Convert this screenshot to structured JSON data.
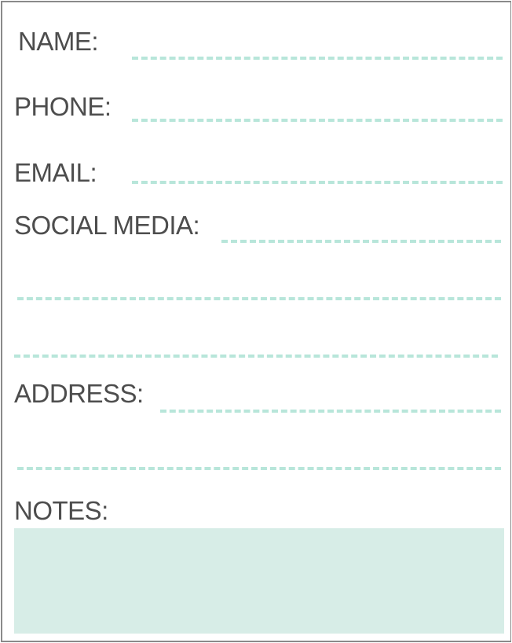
{
  "form": {
    "name_label": "NAME:",
    "phone_label": "PHONE:",
    "email_label": "EMAIL:",
    "social_label": "SOCIAL MEDIA:",
    "address_label": "ADDRESS:",
    "notes_label": "NOTES:"
  },
  "colors": {
    "text": "#4d4d4d",
    "dash": "#b8e6da",
    "notes_fill": "#d7ede7",
    "border": "#8a8a8a"
  }
}
